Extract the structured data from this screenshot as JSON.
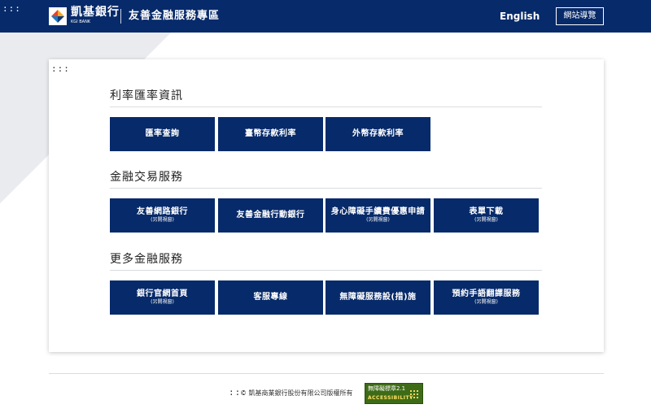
{
  "header": {
    "accesskey": ":::",
    "bank_name": "凱基銀行",
    "bank_sub": "KGI BANK",
    "site_title": "友善金融服務專區",
    "lang_label": "English",
    "sitemap_label": "網站導覽",
    "logo_icon": "kgi-logo-icon",
    "bg_color": "#072a6a"
  },
  "main": {
    "accesskey": ":::",
    "sections": [
      {
        "title": "利率匯率資訊",
        "buttons": [
          {
            "label": "匯率查詢",
            "note": ""
          },
          {
            "label": "臺幣存款利率",
            "note": ""
          },
          {
            "label": "外幣存款利率",
            "note": ""
          }
        ]
      },
      {
        "title": "金融交易服務",
        "buttons": [
          {
            "label": "友善網路銀行",
            "note": "(另開視窗)"
          },
          {
            "label": "友善金融行動銀行",
            "note": ""
          },
          {
            "label": "身心障礙手續費優惠申請",
            "note": "(另開視窗)"
          },
          {
            "label": "表單下載",
            "note": "(另開視窗)"
          }
        ]
      },
      {
        "title": "更多金融服務",
        "buttons": [
          {
            "label": "銀行官網首頁",
            "note": "(另開視窗)"
          },
          {
            "label": "客服專線",
            "note": ""
          },
          {
            "label": "無障礙服務設(措)施",
            "note": ""
          },
          {
            "label": "預約手語翻譯服務",
            "note": "(另開視窗)"
          }
        ]
      }
    ],
    "button_color": "#072a6a"
  },
  "footer": {
    "accesskey": ":::",
    "copyright": "© 凱基商業銀行股份有限公司版權所有",
    "badge_top": "無障礙標章2.1",
    "badge_bottom": "ACCESSIBILITY",
    "badge_color": "#3e6b17"
  }
}
